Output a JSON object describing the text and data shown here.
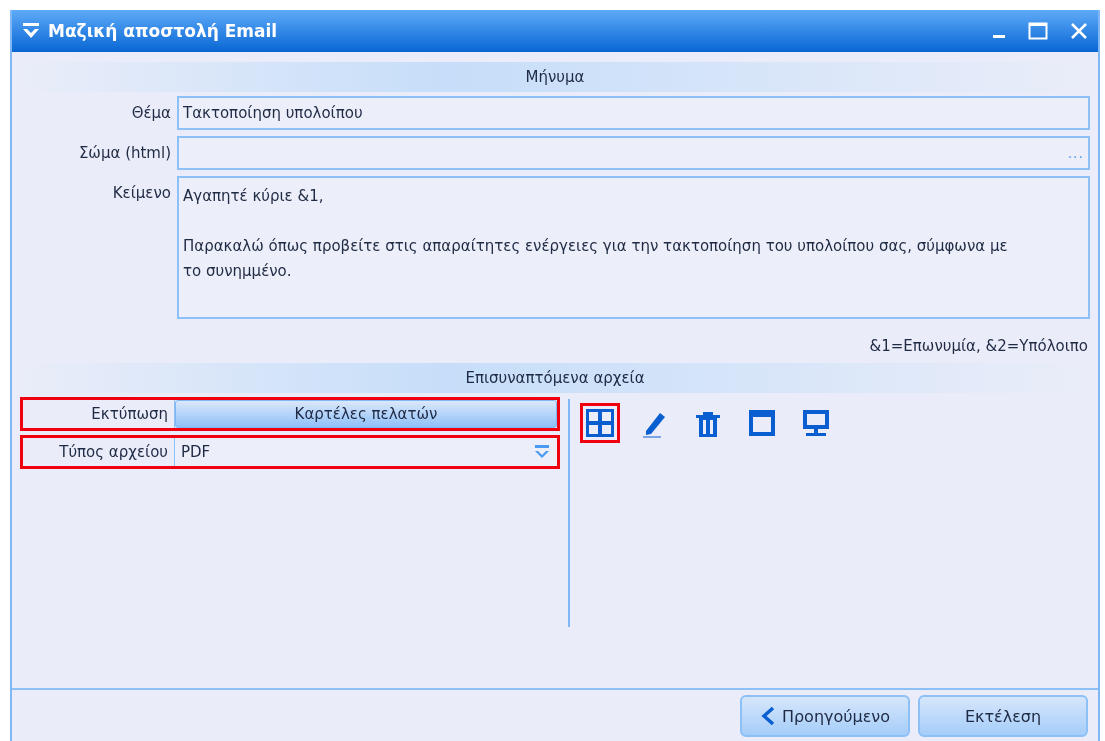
{
  "window": {
    "title": "Μαζική αποστολή Email"
  },
  "message_section": {
    "title": "Μήνυμα",
    "fields": [
      {
        "kind": "text",
        "label": "Θέμα",
        "value": "Τακτοποίηση υπολοίπου"
      },
      {
        "kind": "browse",
        "label": "Σώμα (html)",
        "button": "..."
      },
      {
        "kind": "memo",
        "label": "Κείμενο",
        "paragraphs": [
          "Αγαπητέ κύριε &1,",
          "Παρακαλώ όπως προβείτε στις απαραίτητες ενέργειες για την τακτοποίηση του υπολοίπου σας, σύμφωνα με το συνημμένο."
        ]
      }
    ],
    "legend": "&1=Επωνυμία, &2=Υπόλοιπο"
  },
  "attachments_section": {
    "title": "Επισυναπτόμενα αρχεία",
    "rows": [
      {
        "kind": "button",
        "label": "Εκτύπωση",
        "value": "Καρτέλες πελατών",
        "highlighted": true
      },
      {
        "kind": "dropdown",
        "label": "Τύπος αρχείου",
        "value": "PDF",
        "highlighted": true
      }
    ],
    "tools": [
      {
        "kind": "add",
        "highlighted": true
      },
      {
        "kind": "edit",
        "highlighted": false
      },
      {
        "kind": "delete",
        "highlighted": false
      },
      {
        "kind": "window",
        "highlighted": false
      },
      {
        "kind": "monitor",
        "highlighted": false
      }
    ]
  },
  "buttons": [
    {
      "kind": "back",
      "label": "Προηγούμενο"
    },
    {
      "kind": "run",
      "label": "Εκτέλεση"
    }
  ]
}
